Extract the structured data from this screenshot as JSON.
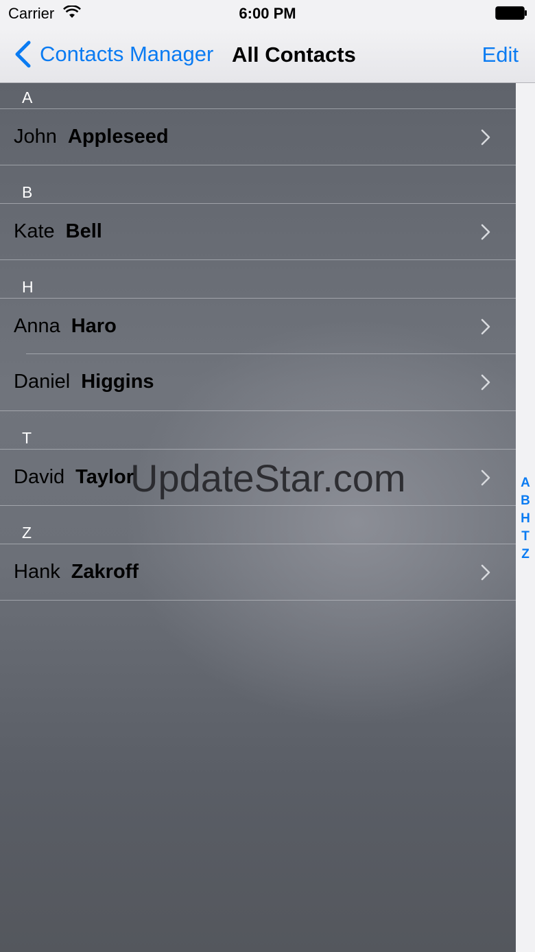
{
  "status_bar": {
    "carrier": "Carrier",
    "time": "6:00 PM",
    "wifi_icon": "wifi-icon",
    "battery_icon": "battery-icon"
  },
  "nav": {
    "back_label": "Contacts Manager",
    "back_icon": "chevron-left-icon",
    "title": "All Contacts",
    "edit_label": "Edit"
  },
  "sections": [
    {
      "letter": "A",
      "contacts": [
        {
          "first": "John",
          "last": "Appleseed"
        }
      ]
    },
    {
      "letter": "B",
      "contacts": [
        {
          "first": "Kate",
          "last": "Bell"
        }
      ]
    },
    {
      "letter": "H",
      "contacts": [
        {
          "first": "Anna",
          "last": "Haro"
        },
        {
          "first": "Daniel",
          "last": "Higgins"
        }
      ]
    },
    {
      "letter": "T",
      "contacts": [
        {
          "first": "David",
          "last": "Taylor"
        }
      ]
    },
    {
      "letter": "Z",
      "contacts": [
        {
          "first": "Hank",
          "last": "Zakroff"
        }
      ]
    }
  ],
  "index": [
    "A",
    "B",
    "H",
    "T",
    "Z"
  ],
  "watermark": "UpdateStar.com",
  "colors": {
    "accent": "#0a7bf2",
    "header_text": "#ffffff"
  }
}
